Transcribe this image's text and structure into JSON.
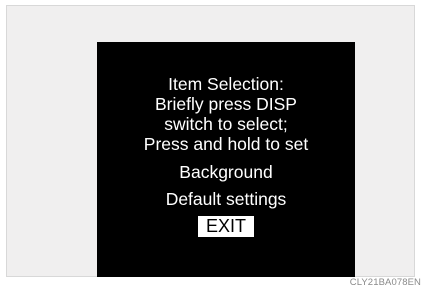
{
  "display": {
    "instructions": [
      "Item Selection:",
      "Briefly press DISP",
      "switch to select;",
      "Press and hold to set"
    ],
    "options": [
      "Background",
      "Default settings"
    ],
    "exit_label": "EXIT",
    "selected_item": "EXIT"
  },
  "figure_code": "CLY21BA078EN",
  "colors": {
    "screen_background": "#000000",
    "text": "#ffffff",
    "highlight_background": "#ffffff",
    "highlight_text": "#000000"
  }
}
